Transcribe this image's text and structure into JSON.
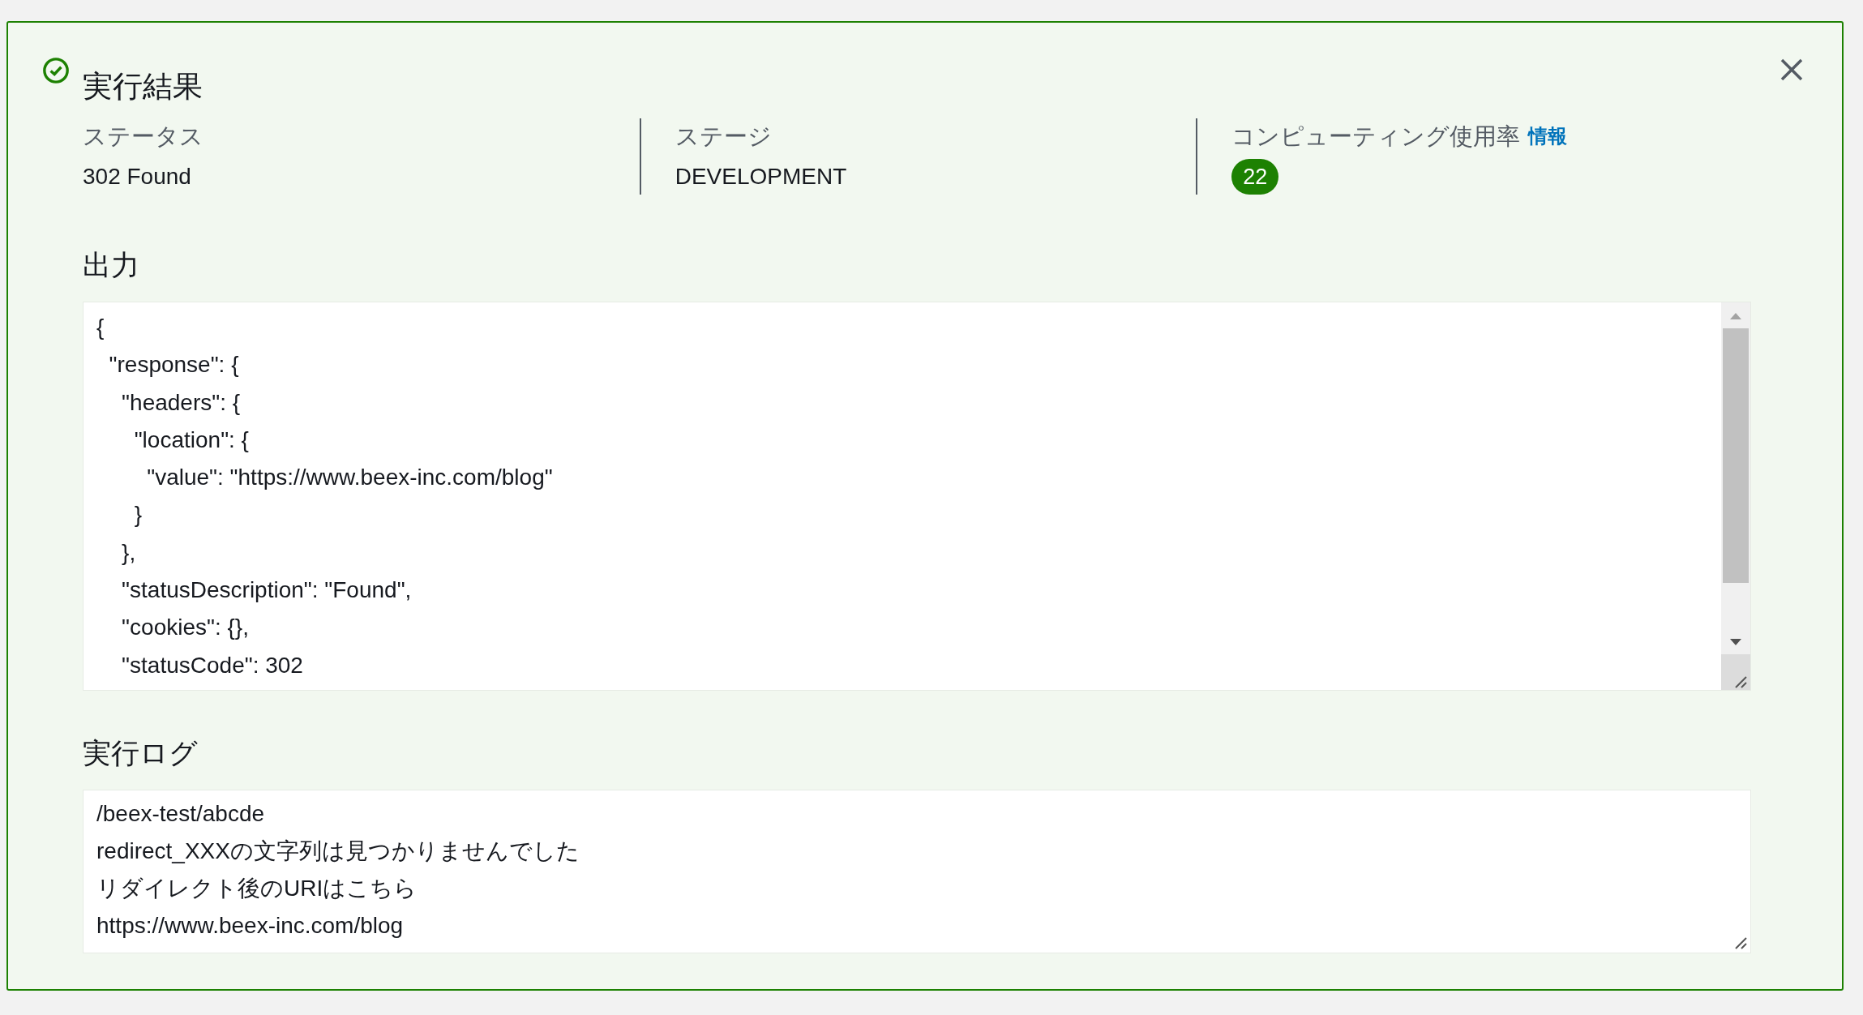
{
  "panel": {
    "title": "実行結果"
  },
  "summary": [
    {
      "kind": "text",
      "label": "ステータス",
      "value": "302 Found"
    },
    {
      "kind": "text",
      "label": "ステージ",
      "value": "DEVELOPMENT"
    },
    {
      "kind": "badge",
      "label": "コンピューティング使用率",
      "info_link": "情報",
      "value": "22"
    }
  ],
  "output": {
    "heading": "出力",
    "lines": [
      "{",
      "  \"response\": {",
      "    \"headers\": {",
      "      \"location\": {",
      "        \"value\": \"https://www.beex-inc.com/blog\"",
      "      }",
      "    },",
      "    \"statusDescription\": \"Found\",",
      "    \"cookies\": {},",
      "    \"statusCode\": 302"
    ]
  },
  "log": {
    "heading": "実行ログ",
    "lines": [
      "/beex-test/abcde",
      "redirect_XXXの文字列は見つかりませんでした",
      "リダイレクト後のURIはこちら",
      "https://www.beex-inc.com/blog"
    ]
  }
}
